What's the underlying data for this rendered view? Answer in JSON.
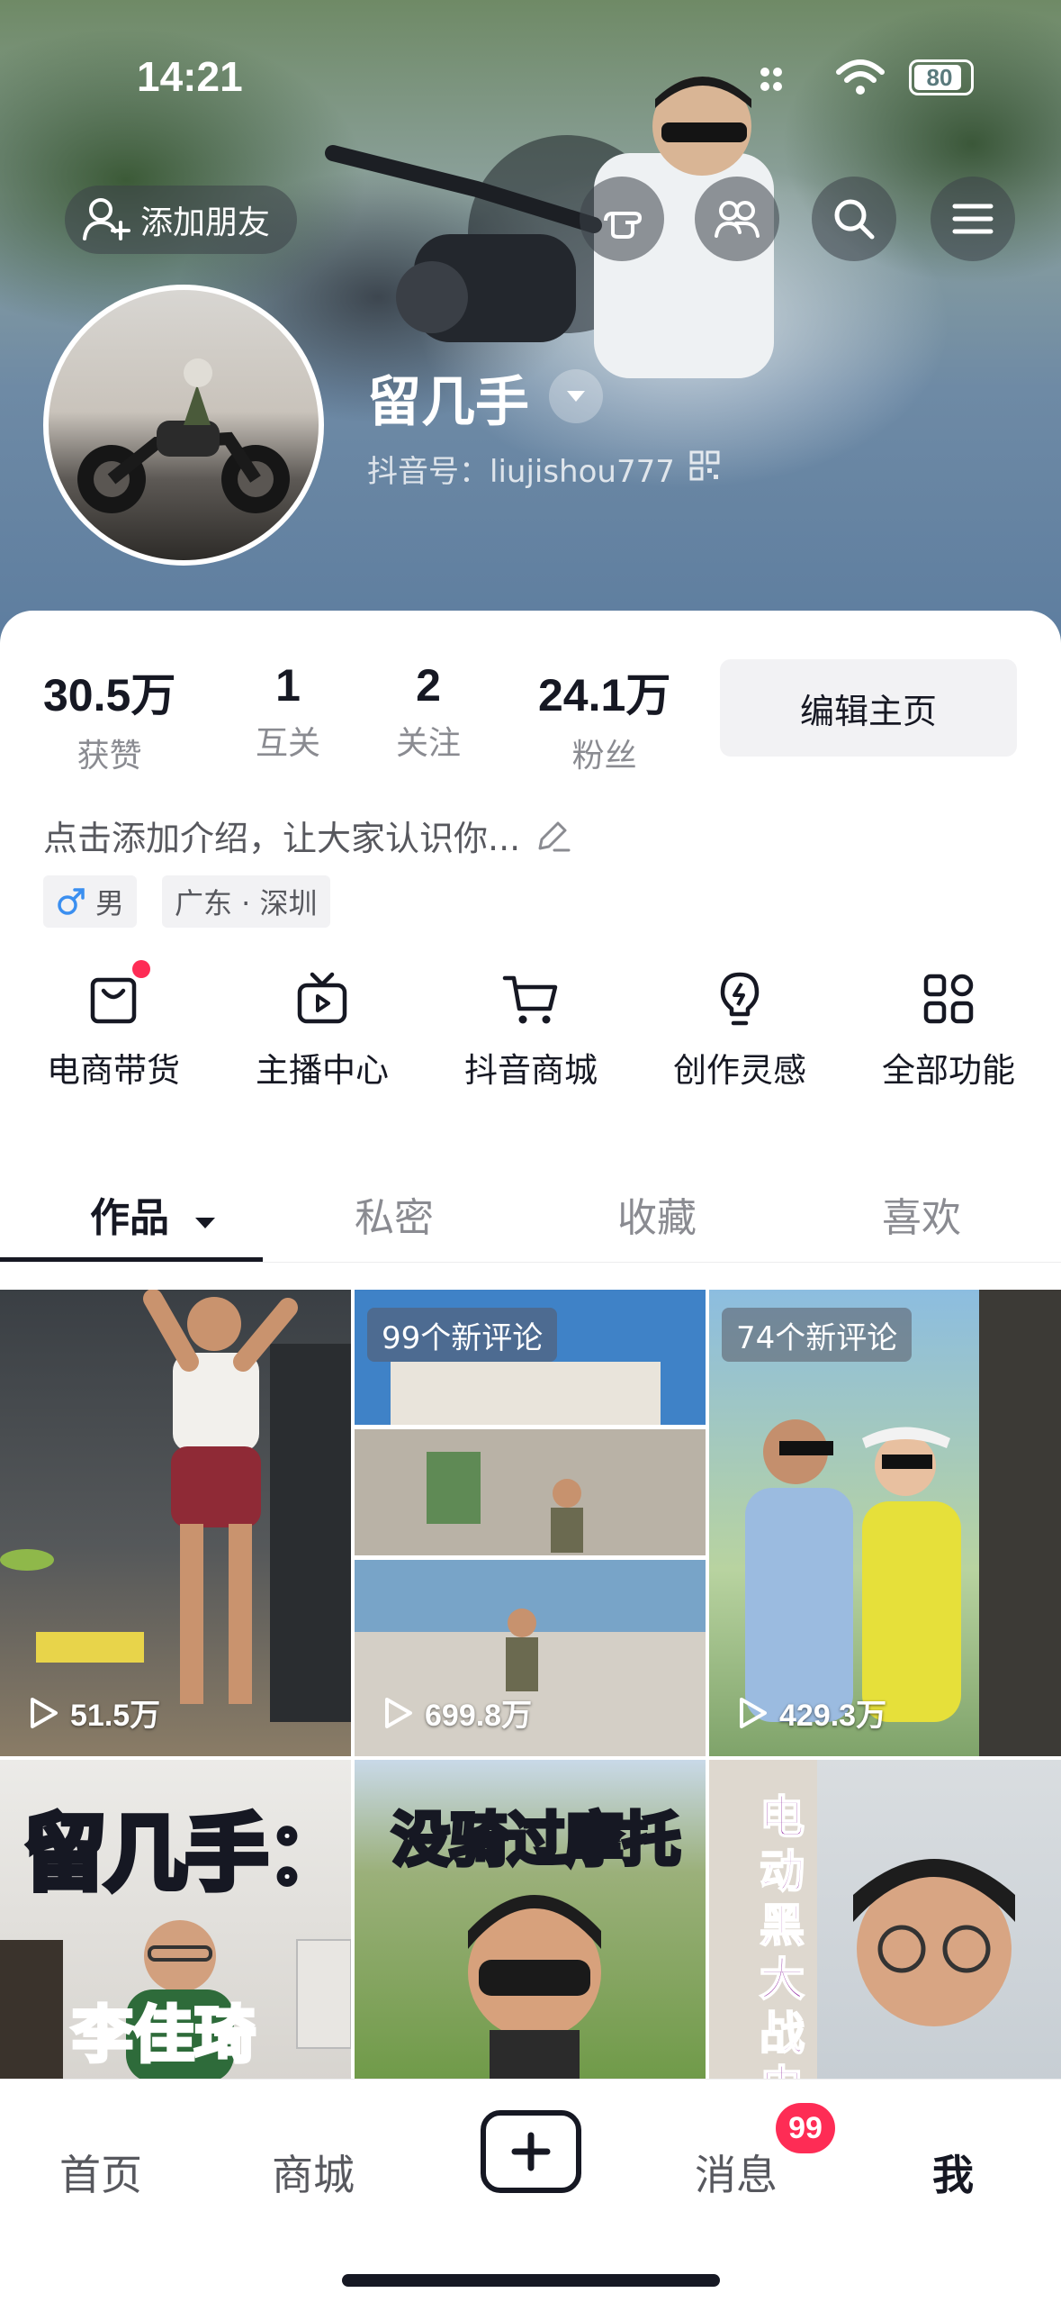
{
  "status_bar": {
    "time": "14:21",
    "battery": "80"
  },
  "header": {
    "add_friend_label": "添加朋友",
    "nickname": "留几手",
    "douyin_id": "抖音号：liujishou777"
  },
  "stats": [
    {
      "value": "30.5万",
      "label": "获赞"
    },
    {
      "value": "1",
      "label": "互关"
    },
    {
      "value": "2",
      "label": "关注"
    },
    {
      "value": "24.1万",
      "label": "粉丝"
    }
  ],
  "edit_profile_label": "编辑主页",
  "bio": "点击添加介绍，让大家认识你...",
  "tags": {
    "gender": "男",
    "location": "广东 · 深圳"
  },
  "functions": [
    {
      "label": "电商带货",
      "icon": "shopping-bag-icon"
    },
    {
      "label": "主播中心",
      "icon": "tv-icon"
    },
    {
      "label": "抖音商城",
      "icon": "cart-icon"
    },
    {
      "label": "创作灵感",
      "icon": "bulb-icon"
    },
    {
      "label": "全部功能",
      "icon": "grid-icon"
    }
  ],
  "tabs": [
    "作品",
    "私密",
    "收藏",
    "喜欢"
  ],
  "videos": [
    {
      "plays": "51.5万"
    },
    {
      "badge": "99个新评论",
      "plays": "699.8万"
    },
    {
      "badge": "74个新评论",
      "plays": "429.3万"
    },
    {
      "caption": "留几手：",
      "caption2": "李佳琦"
    },
    {
      "caption": "没骑过摩托"
    },
    {
      "caption": "电动黑大战电"
    }
  ],
  "bottom_nav": {
    "home": "首页",
    "mall": "商城",
    "messages": "消息",
    "messages_badge": "99",
    "me": "我"
  }
}
